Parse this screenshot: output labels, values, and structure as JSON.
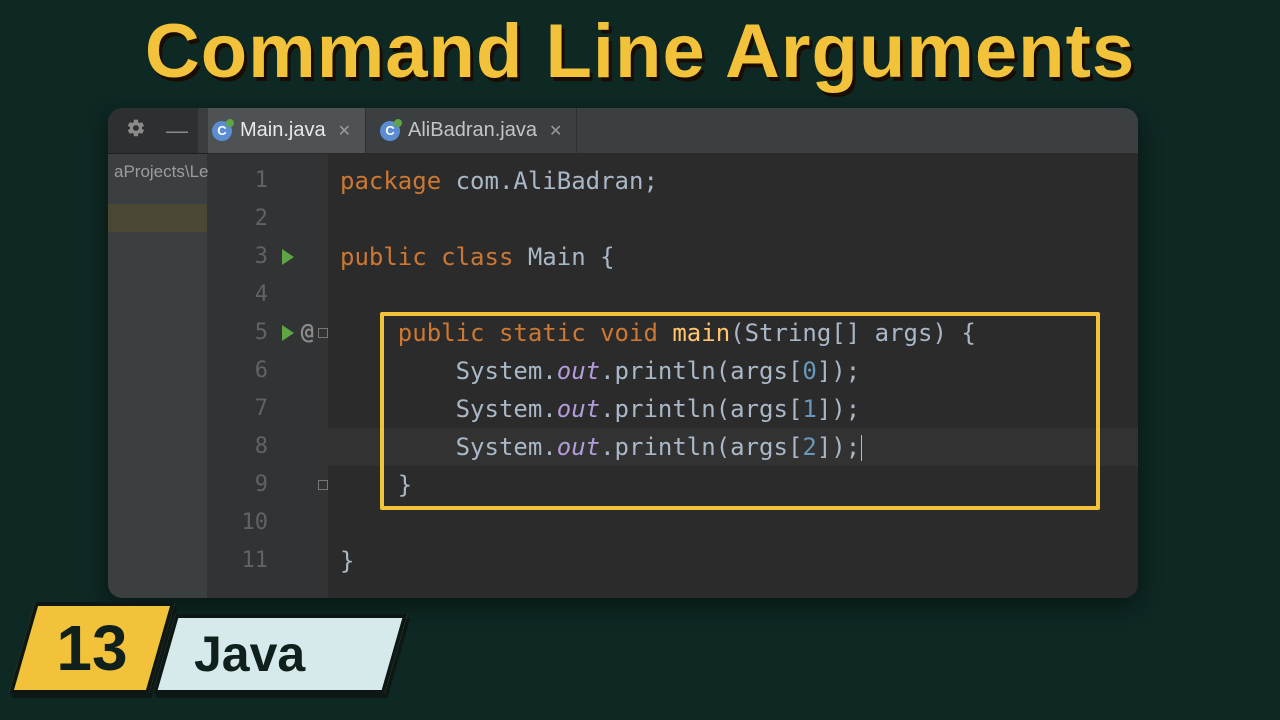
{
  "title": "Command Line Arguments",
  "badge": {
    "number": "13",
    "lang": "Java"
  },
  "tabs": [
    {
      "label": "Main.java",
      "active": true
    },
    {
      "label": "AliBadran.java",
      "active": false
    }
  ],
  "sidepath": "aProjects\\Le",
  "gutter": [
    "1",
    "2",
    "3",
    "4",
    "5",
    "6",
    "7",
    "8",
    "9",
    "10",
    "11"
  ],
  "code": {
    "pkg_kw": "package",
    "pkg_name": " com.AliBadran;",
    "public": "public",
    "class": "class",
    "classname": " Main ",
    "static": "static",
    "void": "void",
    "main": "main",
    "params": "(String[] args) {",
    "sys": "System.",
    "out": "out",
    "println": ".println(args[",
    "idx0": "0",
    "idx1": "1",
    "idx2": "2",
    "tail": "]);",
    "closebrace": "}"
  }
}
